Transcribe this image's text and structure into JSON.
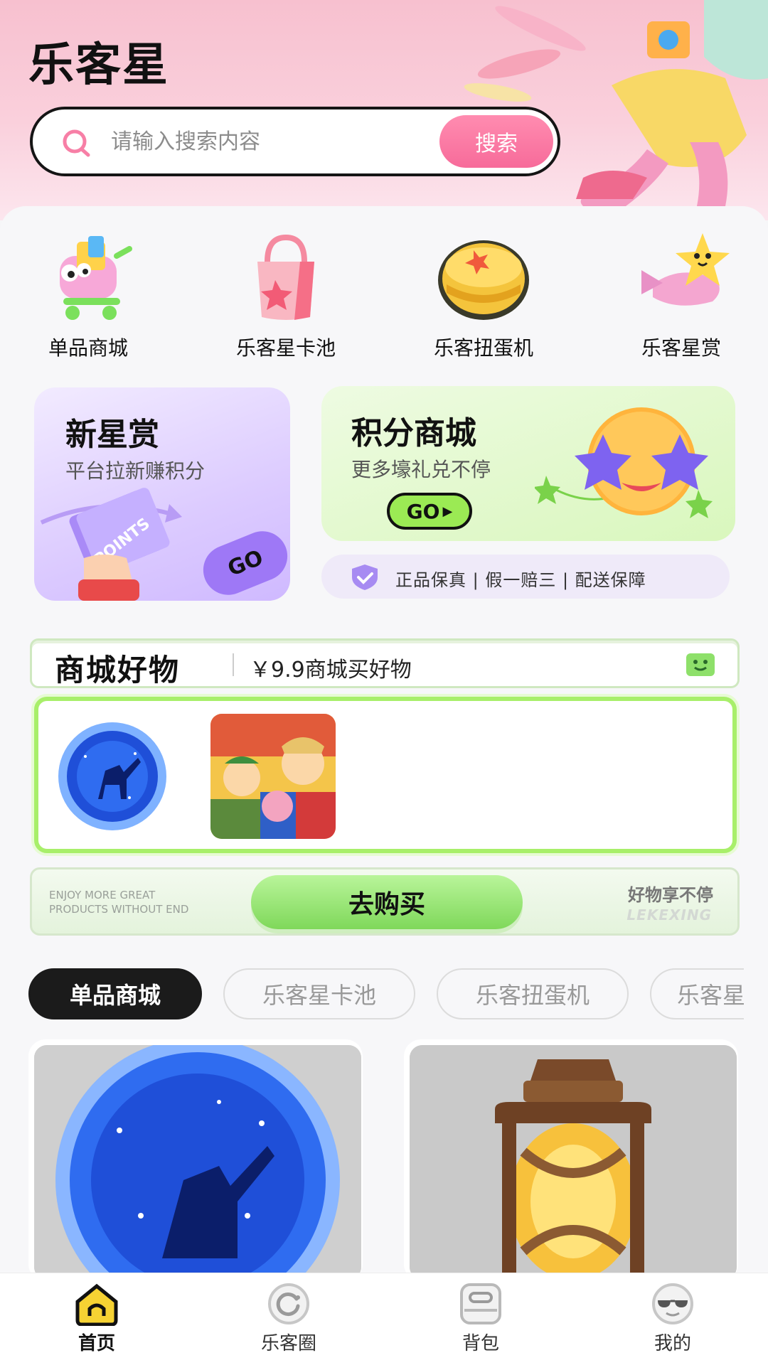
{
  "app": {
    "title": "乐客星"
  },
  "search": {
    "placeholder": "请输入搜索内容",
    "button_label": "搜索"
  },
  "categories": [
    {
      "label": "单品商城",
      "icon": "shopping-cart-icon"
    },
    {
      "label": "乐客星卡池",
      "icon": "shopping-bag-icon"
    },
    {
      "label": "乐客扭蛋机",
      "icon": "gacha-ball-icon"
    },
    {
      "label": "乐客星赏",
      "icon": "star-plane-icon"
    }
  ],
  "promo_new": {
    "title": "新星赏",
    "subtitle": "平台拉新赚积分",
    "button": "GO",
    "ticket_text": "POINTS"
  },
  "promo_points": {
    "title": "积分商城",
    "subtitle": "更多壕礼兑不停",
    "button": "GO"
  },
  "guarantee": {
    "text": "正品保真 | 假一赔三 | 配送保障"
  },
  "mall": {
    "title": "商城好物",
    "subtitle": "￥9.9商城买好物"
  },
  "buy_bar": {
    "en_line1": "ENJOY MORE GREAT",
    "en_line2": "PRODUCTS WITHOUT END",
    "button": "去购买",
    "slogan": "好物享不停",
    "brand": "LEKEXING"
  },
  "tabs": [
    {
      "label": "单品商城",
      "active": true
    },
    {
      "label": "乐客星卡池",
      "active": false
    },
    {
      "label": "乐客扭蛋机",
      "active": false
    },
    {
      "label": "乐客星赏",
      "active": false
    }
  ],
  "nav": [
    {
      "label": "首页",
      "icon": "home-icon",
      "active": true
    },
    {
      "label": "乐客圈",
      "icon": "circle-icon",
      "active": false
    },
    {
      "label": "背包",
      "icon": "backpack-icon",
      "active": false
    },
    {
      "label": "我的",
      "icon": "profile-sunglasses-icon",
      "active": false
    }
  ],
  "colors": {
    "accent_pink": "#f76b9a",
    "accent_green": "#9bea54",
    "accent_purple": "#9e78f6"
  }
}
